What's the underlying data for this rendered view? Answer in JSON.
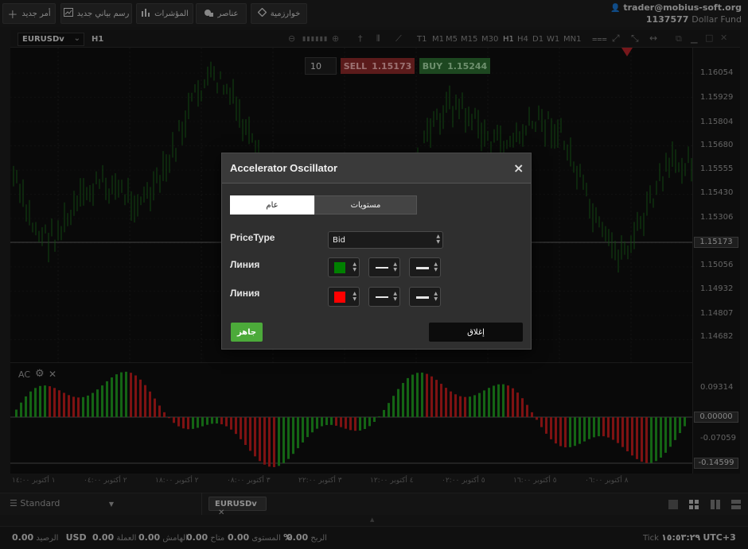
{
  "toolbar": {
    "buttons": [
      {
        "label": "أمر جديد",
        "icon": "plus-icon"
      },
      {
        "label": "رسم بياني جديد",
        "icon": "chart-icon"
      },
      {
        "label": "المؤشرات",
        "icon": "indicators-icon"
      },
      {
        "label": "عناصر",
        "icon": "objects-icon"
      },
      {
        "label": "خوارزمية",
        "icon": "diamond-icon"
      }
    ]
  },
  "account": {
    "email": "trader@mobius-soft.org",
    "number": "1137577",
    "fund": "Dollar Fund"
  },
  "chart": {
    "symbol": "EURUSDv",
    "period": "H1",
    "timeframes": [
      "T1",
      "M1",
      "M5",
      "M15",
      "M30",
      "H1",
      "H4",
      "D1",
      "W1",
      "MN1"
    ],
    "current_price": "1.15173",
    "price_ticks": [
      "1.16054",
      "1.15929",
      "1.15804",
      "1.15680",
      "1.15555",
      "1.15430",
      "1.15306",
      "1.15173",
      "1.15056",
      "1.14932",
      "1.14807",
      "1.14682"
    ],
    "date_ticks": [
      "١ أكتوبر ١٤:٠٠",
      "٢ أكتوبر ٠٤:٠٠",
      "٢ أكتوبر ١٨:٠٠",
      "٣ أكتوبر ٠٨:٠٠",
      "٣ أكتوبر ٢٢:٠٠",
      "٤ أكتوبر ١٢:٠٠",
      "٥ أكتوبر ٠٢:٠٠",
      "٥ أكتوبر ١٦:٠٠",
      "٨ أكتوبر ٠٦:٠٠"
    ]
  },
  "trade": {
    "lots": "10",
    "sell_label": "SELL",
    "sell_price": "1.15173",
    "buy_label": "BUY",
    "buy_price": "1.15244"
  },
  "indicator": {
    "name": "AC",
    "ticks": [
      "0.09314",
      "0.00000",
      "-0.07059",
      "-0.14599"
    ]
  },
  "dialog": {
    "title": "Accelerator Oscillator",
    "tab_general": "عام",
    "tab_levels": "مستويات",
    "price_type_label": "PriceType",
    "price_type_value": "Bid",
    "line1_label": "Линия",
    "line1_color": "#008000",
    "line2_label": "Линия",
    "line2_color": "#ff0000",
    "ok_label": "جاهز",
    "close_label": "إغلاق"
  },
  "bottom": {
    "template": "Standard",
    "chart_tab": "EURUSDv"
  },
  "status": {
    "balance_value": "0.00",
    "balance_label": "الرصيد",
    "currency": "USD",
    "equity_value": "0.00",
    "equity_label": "العملة",
    "margin_value": "0.00",
    "margin_label": "الهامش",
    "free_value": "0.00",
    "free_label": "متاح",
    "level_value": "%",
    "level_label": "المستوى",
    "profit_value": "0.00",
    "profit_label": "الربح",
    "tick_label": "Tick",
    "time": "١٥:٥٣:٢٩",
    "timezone": "UTC+3"
  }
}
